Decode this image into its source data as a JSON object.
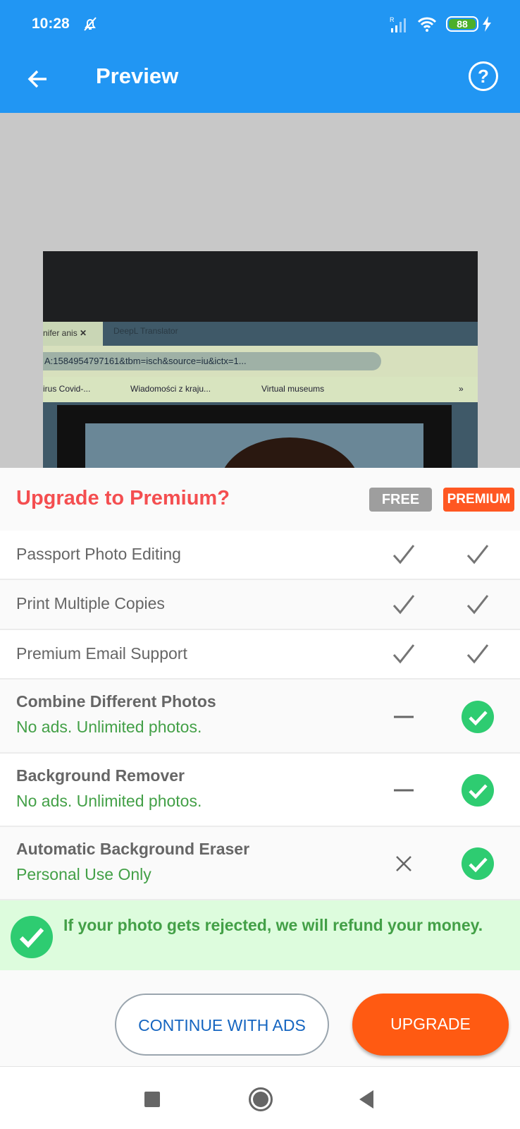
{
  "status_bar": {
    "time": "10:28",
    "battery": "88",
    "icons": [
      "bell-off-icon",
      "signal-icon",
      "wifi-icon",
      "battery-icon",
      "charging-icon"
    ]
  },
  "app_bar": {
    "title": "Preview",
    "back_icon": "arrow-left-icon",
    "help_icon": "help-circle-icon",
    "help_glyph": "?"
  },
  "photo": {
    "tab1": "nifer anis",
    "tab1_close": "✕",
    "tab2": "DeepL Translator",
    "url": "A:1584954797161&tbm=isch&source=iu&ictx=1...",
    "bookmarks": [
      "irus Covid-...",
      "Wiadomości z kraju...",
      "Virtual museums"
    ],
    "more": "»"
  },
  "upgrade": {
    "title": "Upgrade to Premium?",
    "free_label": "FREE",
    "premium_label": "PREMIUM",
    "features": [
      {
        "name": "Passport Photo Editing",
        "free": "check",
        "premium": "check"
      },
      {
        "name": "Print Multiple Copies",
        "free": "check",
        "premium": "check"
      },
      {
        "name": "Premium Email Support",
        "free": "check",
        "premium": "check"
      },
      {
        "name": "Combine Different Photos",
        "note": "No ads. Unlimited photos.",
        "free": "dash",
        "premium": "check-circle"
      },
      {
        "name": "Background Remover",
        "note": "No ads. Unlimited photos.",
        "free": "dash",
        "premium": "check-circle"
      },
      {
        "name": "Automatic Background Eraser",
        "note": "Personal Use Only",
        "free": "cross",
        "premium": "check-circle"
      }
    ],
    "guarantee": "If your photo gets rejected, we will refund your money.",
    "continue_label": "CONTINUE WITH ADS",
    "upgrade_label": "UPGRADE"
  },
  "colors": {
    "primary": "#2196f3",
    "accent": "#ff5722",
    "title_red": "#f44e50",
    "green": "#43a047",
    "check_green": "#2ecc71"
  }
}
